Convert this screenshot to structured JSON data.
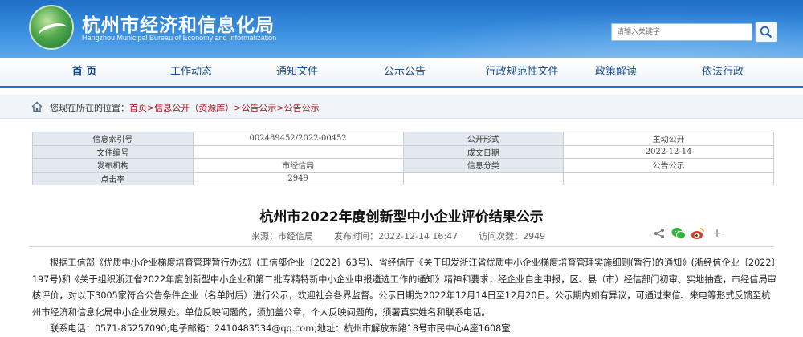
{
  "header": {
    "site_title": "杭州市经济和信息化局",
    "site_subtitle": "Hangzhou Municipal Bureau of Economy and Informatization",
    "search_placeholder": "请输入关键字"
  },
  "nav": {
    "items": [
      "首 页",
      "工作动态",
      "通知文件",
      "公示公告",
      "行政规范性文件",
      "政策解读",
      "依法行政"
    ]
  },
  "breadcrumb": {
    "prefix": "您现在所在的位置：",
    "links": [
      "首页",
      "信息公开（资源库）",
      "公告公示",
      "公告公示"
    ],
    "separator": ">"
  },
  "info_table": {
    "rows": [
      [
        "信息索引号",
        "002489452/2022-00452",
        "公开形式",
        "主动公开"
      ],
      [
        "文件编号",
        "",
        "成文日期",
        "2022-12-14"
      ],
      [
        "发布机构",
        "市经信局",
        "信息分类",
        "公告公示"
      ],
      [
        "点击率",
        "2949",
        "",
        ""
      ]
    ]
  },
  "article": {
    "title": "杭州市2022年度创新型中小企业评价结果公示",
    "source": "来源：市经信局",
    "publish_time": "发布时间：2022-12-14 16:47",
    "views": "访问次数：2949",
    "body": "根据工信部《优质中小企业梯度培育管理暂行办法》(工信部企业〔2022〕63号)、省经信厅《关于印发浙江省优质中小企业梯度培育管理实施细则(暂行)的通知》(浙经信企业〔2022〕197号)和《关于组织浙江省2022年度创新型中小企业和第二批专精特新中小企业申报遴选工作的通知》精神和要求，经企业自主申报，区、县（市）经信部门初审、实地抽查，市经信局审核评价，对以下3005家符合公告条件企业（名单附后）进行公示，欢迎社会各界监督。公示日期为2022年12月14日至12月20日。公示期内如有异议，可通过来信、来电等形式反馈至杭州市经济和信息化局中小企业发展处。单位反映问题的，须加盖公章，个人反映问题的，须署真实姓名和联系电话。",
    "contact": "联系电话：0571-85257090;电子邮箱：2410483534@qq.com;地址：杭州市解放东路18号市民中心A座1608室"
  },
  "colors": {
    "header_blue": "#1f6fc7",
    "breadcrumb_link": "#b0141d",
    "table_label_bg": "#e4e9ef"
  }
}
